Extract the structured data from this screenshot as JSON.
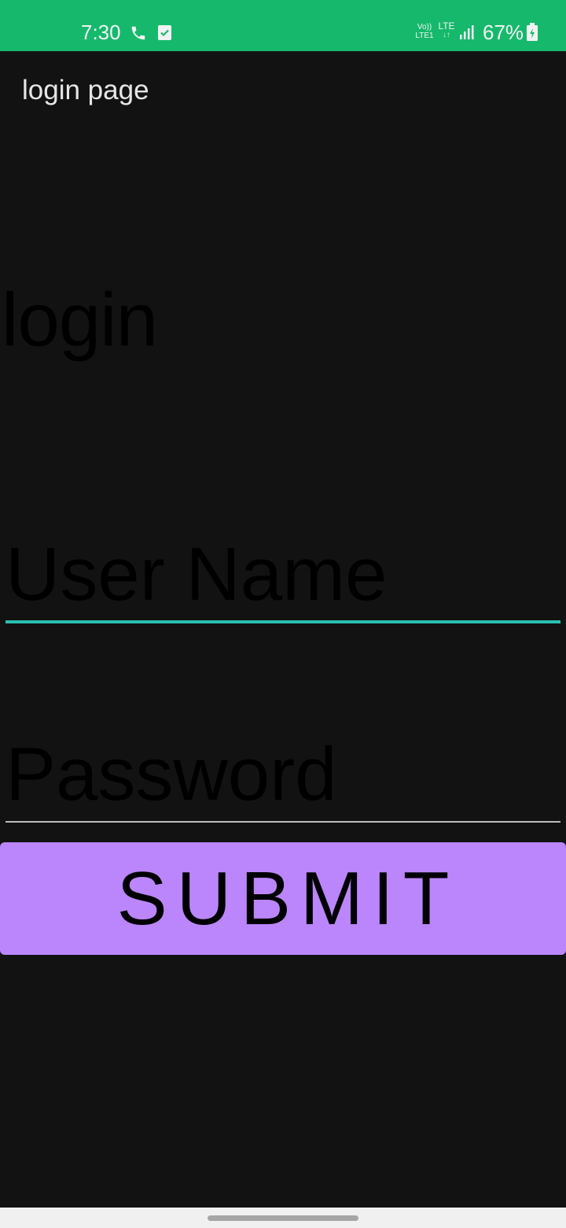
{
  "status_bar": {
    "time": "7:30",
    "volte": "Vo)) LTE1",
    "lte": "LTE",
    "battery": "67%",
    "battery_level": 0.67,
    "icons": [
      "phone-icon",
      "task-check-icon",
      "volte-icon",
      "lte-icon",
      "signal-icon",
      "battery-icon"
    ],
    "background_color": "#16b96c"
  },
  "app_bar": {
    "title": "login page"
  },
  "main": {
    "heading": "login",
    "username": {
      "value": "",
      "placeholder": "User Name"
    },
    "password": {
      "value": "",
      "placeholder": "Password"
    },
    "submit_label": "SUBMIT"
  },
  "colors": {
    "background": "#121212",
    "accent_underline": "#2bbfb2",
    "button": "#bb86fc"
  }
}
